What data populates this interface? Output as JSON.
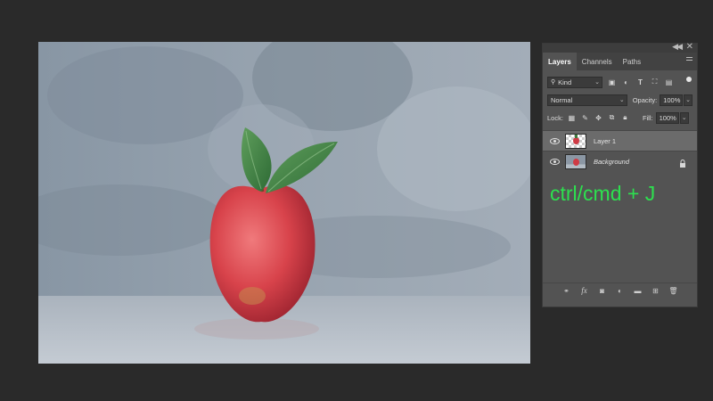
{
  "panel": {
    "tabs": [
      {
        "label": "Layers",
        "active": true
      },
      {
        "label": "Channels",
        "active": false
      },
      {
        "label": "Paths",
        "active": false
      }
    ],
    "filter": {
      "value": "Kind"
    },
    "blend_mode": {
      "value": "Normal"
    },
    "opacity": {
      "label": "Opacity:",
      "value": "100%"
    },
    "lock": {
      "label": "Lock:"
    },
    "fill": {
      "label": "Fill:",
      "value": "100%"
    },
    "layers": [
      {
        "name": "Layer 1",
        "selected": true,
        "visible": true
      },
      {
        "name": "Background",
        "selected": false,
        "visible": true,
        "locked": true
      }
    ]
  },
  "overlay": {
    "shortcut_text": "ctrl/cmd + J",
    "color": "#2de04f"
  },
  "colors": {
    "app_background": "#2a2a2a",
    "panel_background": "#535353",
    "selected_layer": "#6b6b6b"
  },
  "icons": [
    "search-icon",
    "pixel-filter-icon",
    "adjustment-filter-icon",
    "type-filter-icon",
    "shape-filter-icon",
    "smart-object-filter-icon",
    "filter-toggle-icon",
    "lock-transparent-icon",
    "lock-paint-icon",
    "lock-position-icon",
    "lock-artboard-icon",
    "lock-all-icon",
    "eye-icon",
    "lock-icon",
    "link-icon",
    "fx-icon",
    "mask-icon",
    "adjustment-icon",
    "folder-icon",
    "new-layer-icon",
    "trash-icon"
  ]
}
